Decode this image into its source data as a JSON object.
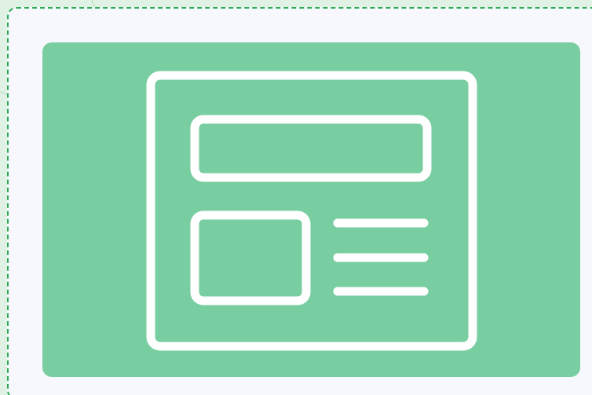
{
  "upload_area": {
    "state": "empty",
    "icon": "webpage-layout-icon",
    "colors": {
      "border": "#2eaa56",
      "surface": "#f7f8fd",
      "panel": "#78cea0",
      "icon_stroke": "#ffffff"
    }
  }
}
